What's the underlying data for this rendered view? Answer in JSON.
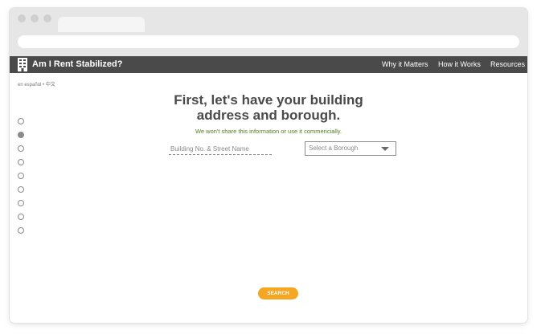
{
  "nav": {
    "site_title": "Am I Rent Stabilized?",
    "links": [
      "Why it Matters",
      "How it Works",
      "Resources"
    ]
  },
  "language": {
    "spanish": "en español",
    "separator": "•",
    "chinese": "中文"
  },
  "steps": {
    "count": 9,
    "active_index": 1
  },
  "main": {
    "heading_line1": "First, let's have your building",
    "heading_line2": "address and borough.",
    "subtext": "We won't share this information or use it commericially."
  },
  "form": {
    "street_placeholder": "Building No. & Street Name",
    "street_value": "",
    "borough_selected": "Select a Borough",
    "search_label": "SEARCH"
  },
  "colors": {
    "navbar": "#4a4a4a",
    "accent": "#f5a623",
    "subtext": "#4f7f1e"
  }
}
